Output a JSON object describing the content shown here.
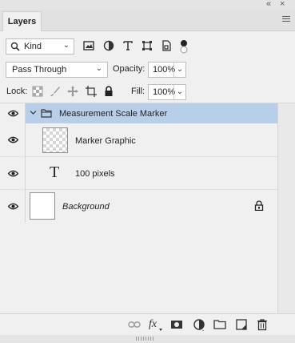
{
  "window": {
    "collapse_glyph": "«",
    "close_glyph": "×"
  },
  "panel": {
    "tab_label": "Layers",
    "menu_icon": "hamburger-menu-icon"
  },
  "filter": {
    "kind_label": "Kind",
    "filter_icons": [
      "image-filter-icon",
      "adjustment-filter-icon",
      "type-filter-icon",
      "shape-filter-icon",
      "smart-object-filter-icon"
    ],
    "toggle_icon": "filter-toggle-icon"
  },
  "blend": {
    "mode": "Pass Through",
    "opacity_label": "Opacity:",
    "opacity_value": "100%"
  },
  "lock": {
    "label": "Lock:",
    "fill_label": "Fill:",
    "fill_value": "100%"
  },
  "layers": [
    {
      "name": "Measurement Scale Marker",
      "type": "group",
      "selected": true,
      "visible": true
    },
    {
      "name": "Marker Graphic",
      "type": "pixel",
      "selected": false,
      "visible": true
    },
    {
      "name": "100 pixels",
      "type": "text",
      "selected": false,
      "visible": true
    },
    {
      "name": "Background",
      "type": "background",
      "selected": false,
      "visible": true,
      "locked": true
    }
  ],
  "bottom_toolbar": [
    "link-layers-icon",
    "fx-icon",
    "layer-mask-icon",
    "adjustment-layer-icon",
    "new-group-icon",
    "new-layer-icon",
    "delete-icon"
  ],
  "colors": {
    "selection": "#b8cfe9",
    "panel_bg": "#f0f0f0"
  }
}
